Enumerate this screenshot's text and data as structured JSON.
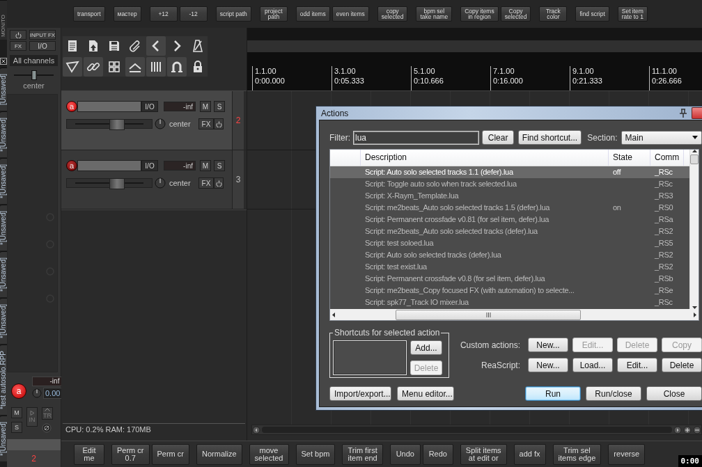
{
  "monitor_tab": "MONITO",
  "project_tabs": [
    "[Unsaved]",
    "*[Unsaved]",
    "*[Unsaved]",
    "*[Unsaved]",
    "*[Unsaved]",
    "*[Unsaved]",
    "*test autosolo.RPP",
    "*[Unsaved]"
  ],
  "top_toolbar": [
    [
      "transport"
    ],
    [
      "мастер"
    ],
    [
      "+12",
      "-12"
    ],
    [
      "script path"
    ],
    [
      "project\npath"
    ],
    [
      "odd items",
      "even items"
    ],
    [
      "copy\nselected"
    ],
    [
      "bpm sel\ntake name"
    ],
    [
      "Copy items\nin region",
      "Copy\nselected"
    ],
    [
      "Track\ncolor"
    ],
    [
      "find script"
    ],
    [
      "Set item\nrate to 1"
    ]
  ],
  "master": {
    "input_fx": "INPUT FX",
    "fx": "FX",
    "io": "I/O",
    "channels": "All channels",
    "pan": {
      "level": 0.5,
      "label": "center"
    },
    "arm": "a",
    "meter": "-inf",
    "volume": "0.00",
    "mute": "M",
    "solo": "S",
    "input": "IN",
    "trim": "TR",
    "number": "2"
  },
  "tcp_toolbar": [
    {
      "on": false
    },
    {
      "on": false
    },
    {
      "on": false
    },
    {
      "on": false
    },
    {
      "on": true
    },
    {
      "on": false
    },
    {
      "on": false
    },
    {
      "on": true
    },
    {
      "on": true
    },
    {
      "on": false
    },
    {
      "on": true
    },
    {
      "on": true
    },
    {
      "on": true
    },
    {
      "on": false
    }
  ],
  "tracks": [
    {
      "selected": true,
      "arm": "a",
      "io": "I/O",
      "meter": "-inf",
      "mute": "M",
      "solo": "S",
      "volume": {
        "level": 0.6
      },
      "pan_label": "center",
      "fx": "FX",
      "number": "2"
    },
    {
      "selected": false,
      "arm": "a",
      "io": "I/O",
      "meter": "-inf",
      "mute": "M",
      "solo": "S",
      "volume": {
        "level": 0.6
      },
      "pan_label": "center",
      "fx": "FX",
      "number": "3"
    }
  ],
  "status": "CPU: 0.2%  RAM: 170MB",
  "ruler": [
    {
      "bar": "1.1.00",
      "time": "0:00.000"
    },
    {
      "bar": "3.1.00",
      "time": "0:05.333"
    },
    {
      "bar": "5.1.00",
      "time": "0:10.666"
    },
    {
      "bar": "7.1.00",
      "time": "0:16.000"
    },
    {
      "bar": "9.1.00",
      "time": "0:21.333"
    },
    {
      "bar": "11.1.00",
      "time": "0:26.666"
    }
  ],
  "actions_dialog": {
    "title": "Actions",
    "filter_label": "Filter:",
    "filter_value": "lua",
    "clear": "Clear",
    "find_shortcut": "Find shortcut...",
    "section_label": "Section:",
    "section_value": "Main",
    "columns": [
      "Description",
      "State",
      "Comm"
    ],
    "rows": [
      {
        "description": "Script: Auto solo selected tracks 1.1 (defer).lua",
        "state": "off",
        "command": "_RSc",
        "selected": true
      },
      {
        "description": "Script: Toggle auto solo when track selected.lua",
        "command": "_RSc",
        "selected": false
      },
      {
        "description": "Script: X-Raym_Template.lua",
        "command": "_RS3",
        "selected": false
      },
      {
        "description": "Script: me2beats_Auto solo selected tracks 1.5 (defer).lua",
        "state": "on",
        "command": "_RS0",
        "selected": false
      },
      {
        "description": "Script: Permanent crossfade v0.81 (for sel item, defer).lua",
        "command": "_RSa",
        "selected": false
      },
      {
        "description": "Script: me2beats_Auto solo selected tracks (defer).lua",
        "command": "_RS2",
        "selected": false
      },
      {
        "description": "Script: test soloed.lua",
        "command": "_RS5",
        "selected": false
      },
      {
        "description": "Script: Auto solo selected tracks (defer).lua",
        "command": "_RS2",
        "selected": false
      },
      {
        "description": "Script: test exist.lua",
        "command": "_RS2",
        "selected": false
      },
      {
        "description": "Script: Permanent crossfade v0.8 (for sel item, defer).lua",
        "command": "_RSb",
        "selected": false
      },
      {
        "description": "Script: me2beats_Copy focused FX (with automation) to selecte...",
        "command": "_RSe",
        "selected": false
      },
      {
        "description": "Script: spk77_Track IO mixer.lua",
        "command": "_RSc",
        "selected": false
      }
    ],
    "shortcuts_title": "Shortcuts for selected action",
    "shortcut_buttons": [
      {
        "label": "Add...",
        "disabled": false
      },
      {
        "label": "Delete",
        "disabled": true
      }
    ],
    "button_rows": [
      {
        "label": "Custom actions:",
        "buttons": [
          {
            "label": "New...",
            "disabled": false
          },
          {
            "label": "Edit...",
            "disabled": true
          },
          {
            "label": "Delete",
            "disabled": true
          },
          {
            "label": "Copy",
            "disabled": true
          }
        ]
      },
      {
        "label": "ReaScript:",
        "buttons": [
          {
            "label": "New...",
            "disabled": false
          },
          {
            "label": "Load...",
            "disabled": false
          },
          {
            "label": "Edit...",
            "disabled": false
          },
          {
            "label": "Delete",
            "disabled": false
          }
        ]
      }
    ],
    "footer_left": [
      "Import/export...",
      "Menu editor..."
    ],
    "footer_right": [
      {
        "label": "Run",
        "default": true
      },
      {
        "label": "Run/close",
        "default": false
      },
      {
        "label": "Close",
        "default": false
      }
    ]
  },
  "bottom_toolbar": [
    [
      "Edit\nme"
    ],
    [
      "Perm cr\n0.7",
      "Perm cr"
    ],
    [
      "Normalize"
    ],
    [
      "move\nselected"
    ],
    [
      "Set bpm"
    ],
    [
      "Trim first\nitem end"
    ],
    [
      "Undo",
      "Redo"
    ],
    [
      "Split items\nat edit or"
    ],
    [
      "add fx"
    ],
    [
      "Trim sel\nitems edge"
    ],
    [
      "reverse"
    ]
  ],
  "time_display": "0:00"
}
